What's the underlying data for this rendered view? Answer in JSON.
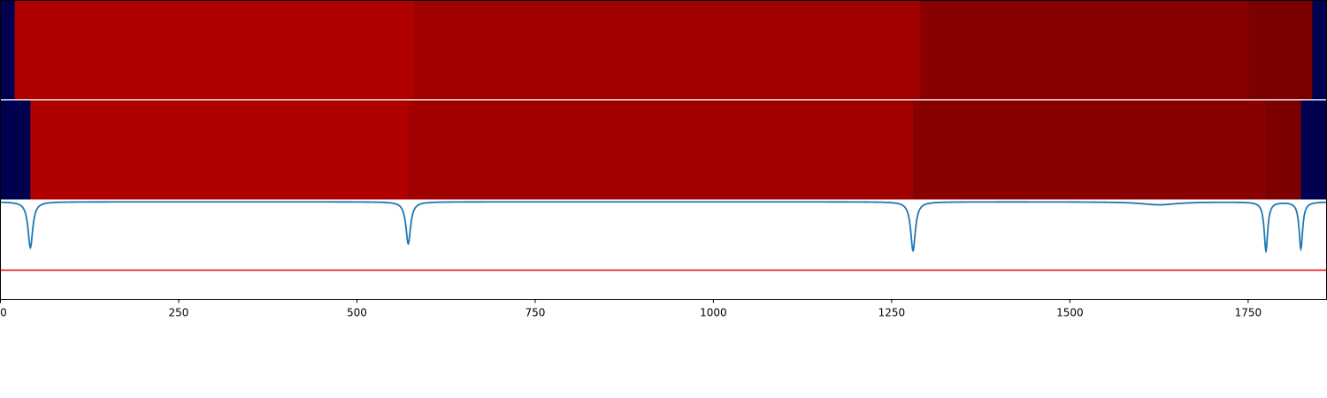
{
  "chart_data": {
    "type": "heatmap",
    "xlim": [
      0,
      1860
    ],
    "x_ticks": [
      0,
      250,
      500,
      750,
      1000,
      1250,
      1500,
      1750
    ],
    "x_tick_labels": [
      "0",
      "250",
      "500",
      "750",
      "1000",
      "1250",
      "1500",
      "1750"
    ],
    "colors": {
      "background_segment": "#000050",
      "level_1": "#b00000",
      "level_2": "#a10000",
      "level_3": "#890000",
      "level_4": "#7c0000",
      "signal_line": "#1f77b4",
      "threshold_line": "#e8191c"
    },
    "rows": [
      {
        "segments": [
          {
            "start": 0,
            "end": 20,
            "level": "background_segment"
          },
          {
            "start": 20,
            "end": 580,
            "level": "level_1"
          },
          {
            "start": 580,
            "end": 1290,
            "level": "level_2"
          },
          {
            "start": 1290,
            "end": 1750,
            "level": "level_3"
          },
          {
            "start": 1750,
            "end": 1840,
            "level": "level_4"
          },
          {
            "start": 1840,
            "end": 1860,
            "level": "background_segment"
          }
        ]
      },
      {
        "segments": [
          {
            "start": 0,
            "end": 42,
            "level": "background_segment"
          },
          {
            "start": 42,
            "end": 572,
            "level": "level_1"
          },
          {
            "start": 572,
            "end": 1280,
            "level": "level_2"
          },
          {
            "start": 1280,
            "end": 1775,
            "level": "level_3"
          },
          {
            "start": 1775,
            "end": 1824,
            "level": "level_4"
          },
          {
            "start": 1824,
            "end": 1860,
            "level": "background_segment"
          }
        ]
      }
    ],
    "signal": {
      "baseline": 0,
      "ylim": [
        -1.0,
        0.02
      ],
      "threshold": -0.7,
      "dips": [
        {
          "x": 42,
          "depth": 0.47,
          "width": 4
        },
        {
          "x": 572,
          "depth": 0.43,
          "width": 4
        },
        {
          "x": 1280,
          "depth": 0.5,
          "width": 4
        },
        {
          "x": 1625,
          "depth": 0.03,
          "width": 30
        },
        {
          "x": 1775,
          "depth": 0.5,
          "width": 3
        },
        {
          "x": 1824,
          "depth": 0.48,
          "width": 3
        }
      ]
    }
  }
}
